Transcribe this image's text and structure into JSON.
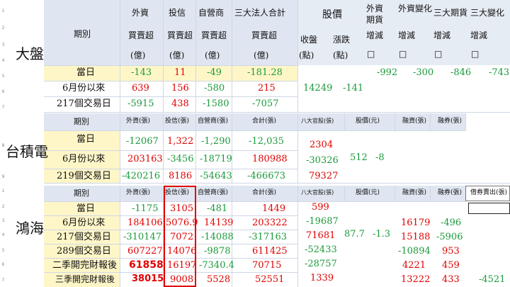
{
  "row_numbers": [
    "1",
    "2",
    "3",
    "4",
    "5",
    "6",
    "7",
    "8",
    "9",
    "1",
    "2",
    "3",
    "4",
    "5",
    "6",
    "7"
  ],
  "taiex": {
    "label": "大盤",
    "h1": {
      "period": "期別",
      "foreign": "外資",
      "trust": "投信",
      "dealer": "自營商",
      "total": "三大法人合計",
      "price": "股價",
      "fut": "外資期貨",
      "futchg": "外資變化",
      "big3fut": "三大期貨",
      "big3chg": "三大變化"
    },
    "h2": {
      "foreign": "買賣超",
      "trust": "買賣超",
      "dealer": "買賣超",
      "total": "買賣超",
      "close": "收盤",
      "chg": "漲跌",
      "fut_sub": "增減",
      "futchg_sub": "增減",
      "big3fut_sub": "增減",
      "big3chg_sub": "增減"
    },
    "h3": {
      "foreign": "(億)",
      "trust": "(億)",
      "dealer": "(億)",
      "total": "(億)",
      "close_unit": "(點)",
      "chg_unit": "(點)",
      "box": "□"
    },
    "rows": [
      {
        "label": "當日",
        "foreign": "-143",
        "trust": "11",
        "dealer": "-49",
        "total": "-181.28"
      },
      {
        "label": "6月份以來",
        "foreign": "639",
        "trust": "156",
        "dealer": "-580",
        "total": "215"
      },
      {
        "label": "217個交易日",
        "foreign": "-5915",
        "trust": "438",
        "dealer": "-1580",
        "total": "-7057"
      }
    ],
    "close": "14249",
    "chg": "-141",
    "fut": "-992",
    "futchg": "-300",
    "big3fut": "-846",
    "big3chg": "-743"
  },
  "tsmc": {
    "label": "台積電",
    "h": {
      "period": "期別",
      "foreign": "外資(張)",
      "trust": "投信(張)",
      "dealer": "自營商(張)",
      "total": "合計(張)",
      "eight": "八大官股(張)",
      "price": "股價(元)",
      "margin": "融資(張)",
      "short": "融券(張)"
    },
    "rows": [
      {
        "label": "當日",
        "foreign": "-12067",
        "trust": "1,322",
        "dealer": "-1,290",
        "total": "-12,035",
        "eight": "2304"
      },
      {
        "label": "6月份以來",
        "foreign": "203163",
        "trust": "-3456",
        "dealer": "-18719",
        "total": "180988",
        "eight": "-30326"
      },
      {
        "label": "219個交易日",
        "foreign": "-420216",
        "trust": "8186",
        "dealer": "-54643",
        "total": "-466673",
        "eight": "79327"
      }
    ],
    "price": "512",
    "chg": "-8"
  },
  "hon": {
    "label": "鴻海",
    "h": {
      "period": "期別",
      "foreign": "外資(張)",
      "trust": "投信(張)",
      "dealer": "自營商(張)",
      "total": "合計(張)",
      "eight": "八大官股(張)",
      "price": "股價(元)",
      "margin": "融資(張)",
      "short": "融券(張)",
      "lend": "借券賣出(張)"
    },
    "rows": [
      {
        "label": "當日",
        "foreign": "-1175",
        "trust": "3105",
        "dealer": "-481",
        "total": "1449",
        "eight": "599",
        "margin": "",
        "short": "",
        "lend": ""
      },
      {
        "label": "6月份以來",
        "foreign": "184106",
        "trust": "5076.9",
        "dealer": "14139",
        "total": "203322",
        "eight": "-19687",
        "margin": "16179",
        "short": "-496",
        "lend": ""
      },
      {
        "label": "217個交易日",
        "foreign": "-310147",
        "trust": "7072",
        "dealer": "-14088",
        "total": "-317163",
        "eight": "71681",
        "margin": "15188",
        "short": "-5906",
        "lend": ""
      },
      {
        "label": "289個交易日",
        "foreign": "607227",
        "trust": "14076",
        "dealer": "-9878",
        "total": "611425",
        "eight": "-52433",
        "margin": "-10894",
        "short": "953",
        "lend": ""
      },
      {
        "label": "二季開完財報後",
        "foreign": "61858",
        "trust": "16197",
        "dealer": "-7340.4",
        "total": "70715",
        "eight": "-28757",
        "margin": "4221",
        "short": "459",
        "lend": ""
      },
      {
        "label": "三季開完財報後",
        "foreign": "38015",
        "trust": "9008",
        "dealer": "5528",
        "total": "52551",
        "eight": "1339",
        "margin": "13222",
        "short": "433",
        "lend": "-4521"
      }
    ],
    "price": "87.7",
    "chg": "-1.3"
  }
}
